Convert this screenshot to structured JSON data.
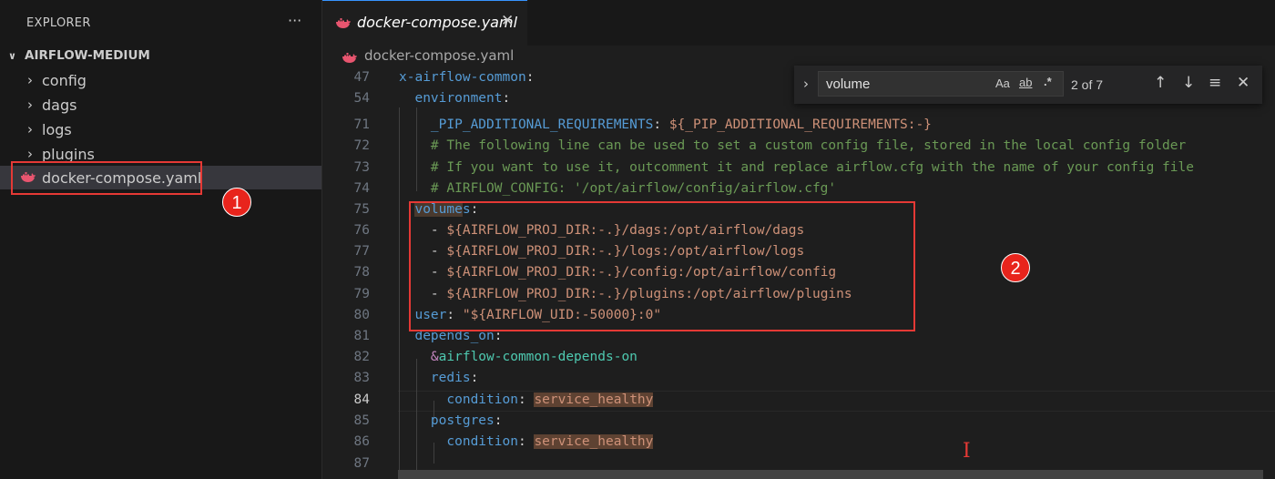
{
  "sidebar": {
    "title": "EXPLORER",
    "more_icon": "ellipsis-icon",
    "more_label": "···",
    "root_label": "AIRFLOW-MEDIUM",
    "items": [
      {
        "label": "config"
      },
      {
        "label": "dags"
      },
      {
        "label": "logs"
      },
      {
        "label": "plugins"
      },
      {
        "label": "docker-compose.yaml"
      }
    ]
  },
  "tab": {
    "label": "docker-compose.yaml",
    "close": "✕"
  },
  "breadcrumb": {
    "label": "docker-compose.yaml"
  },
  "find": {
    "value": "volume",
    "match_case": "Aa",
    "whole_word": "ab",
    "regex": ".*",
    "count": "2 of 7",
    "prev": "↑",
    "next": "↓",
    "selection": "≡",
    "close": "✕",
    "toggle": "›"
  },
  "annotations": {
    "badge1": "1",
    "badge2": "2"
  },
  "colors": {
    "annotation_red": "#e53935",
    "accent": "#3794ff",
    "editor_bg": "#1e1e1e"
  },
  "code": {
    "lines": [
      {
        "n": "47",
        "parts": [
          {
            "t": "x-airflow-common",
            "c": "k"
          },
          {
            "t": ":",
            "c": "w"
          }
        ]
      },
      {
        "n": "54",
        "parts": [
          {
            "t": "  ",
            "c": "w"
          },
          {
            "t": "environment",
            "c": "k"
          },
          {
            "t": ":",
            "c": "w"
          }
        ]
      },
      {
        "n": "71",
        "parts": [
          {
            "t": "    ",
            "c": "w"
          },
          {
            "t": "_PIP_ADDITIONAL_REQUIREMENTS",
            "c": "k"
          },
          {
            "t": ": ",
            "c": "w"
          },
          {
            "t": "${_PIP_ADDITIONAL_REQUIREMENTS:-}",
            "c": "s"
          }
        ]
      },
      {
        "n": "72",
        "parts": [
          {
            "t": "    ",
            "c": "w"
          },
          {
            "t": "# The following line can be used to set a custom config file, stored in the local config folder",
            "c": "c"
          }
        ]
      },
      {
        "n": "73",
        "parts": [
          {
            "t": "    ",
            "c": "w"
          },
          {
            "t": "# If you want to use it, outcomment it and replace airflow.cfg with the name of your config file",
            "c": "c"
          }
        ]
      },
      {
        "n": "74",
        "parts": [
          {
            "t": "    ",
            "c": "w"
          },
          {
            "t": "# AIRFLOW_CONFIG: '/opt/airflow/config/airflow.cfg'",
            "c": "c"
          }
        ]
      },
      {
        "n": "75",
        "parts": [
          {
            "t": "  ",
            "c": "w"
          },
          {
            "t": "volume",
            "c": "k hl"
          },
          {
            "t": "s",
            "c": "k"
          },
          {
            "t": ":",
            "c": "w"
          }
        ]
      },
      {
        "n": "76",
        "parts": [
          {
            "t": "    - ",
            "c": "w"
          },
          {
            "t": "${AIRFLOW_PROJ_DIR:-.}/dags:/opt/airflow/dags",
            "c": "s"
          }
        ]
      },
      {
        "n": "77",
        "parts": [
          {
            "t": "    - ",
            "c": "w"
          },
          {
            "t": "${AIRFLOW_PROJ_DIR:-.}/logs:/opt/airflow/logs",
            "c": "s"
          }
        ]
      },
      {
        "n": "78",
        "parts": [
          {
            "t": "    - ",
            "c": "w"
          },
          {
            "t": "${AIRFLOW_PROJ_DIR:-.}/config:/opt/airflow/config",
            "c": "s"
          }
        ]
      },
      {
        "n": "79",
        "parts": [
          {
            "t": "    - ",
            "c": "w"
          },
          {
            "t": "${AIRFLOW_PROJ_DIR:-.}/plugins:/opt/airflow/plugins",
            "c": "s"
          }
        ]
      },
      {
        "n": "80",
        "parts": [
          {
            "t": "  ",
            "c": "w"
          },
          {
            "t": "user",
            "c": "k"
          },
          {
            "t": ": ",
            "c": "w"
          },
          {
            "t": "\"${AIRFLOW_UID:-50000}:0\"",
            "c": "s"
          }
        ]
      },
      {
        "n": "81",
        "parts": [
          {
            "t": "  ",
            "c": "w"
          },
          {
            "t": "depends_on",
            "c": "k"
          },
          {
            "t": ":",
            "c": "w"
          }
        ]
      },
      {
        "n": "82",
        "parts": [
          {
            "t": "    ",
            "c": "w"
          },
          {
            "t": "&",
            "c": "anc"
          },
          {
            "t": "airflow-common-depends-on",
            "c": "al"
          }
        ]
      },
      {
        "n": "83",
        "parts": [
          {
            "t": "    ",
            "c": "w"
          },
          {
            "t": "redis",
            "c": "k"
          },
          {
            "t": ":",
            "c": "w"
          }
        ]
      },
      {
        "n": "84",
        "current": true,
        "parts": [
          {
            "t": "      ",
            "c": "w"
          },
          {
            "t": "condition",
            "c": "k"
          },
          {
            "t": ": ",
            "c": "w"
          },
          {
            "t": "service_healthy",
            "c": "s match"
          }
        ]
      },
      {
        "n": "85",
        "parts": [
          {
            "t": "    ",
            "c": "w"
          },
          {
            "t": "postgres",
            "c": "k"
          },
          {
            "t": ":",
            "c": "w"
          }
        ]
      },
      {
        "n": "86",
        "parts": [
          {
            "t": "      ",
            "c": "w"
          },
          {
            "t": "condition",
            "c": "k"
          },
          {
            "t": ": ",
            "c": "w"
          },
          {
            "t": "service_healthy",
            "c": "s match"
          }
        ]
      },
      {
        "n": "87",
        "parts": []
      }
    ]
  }
}
